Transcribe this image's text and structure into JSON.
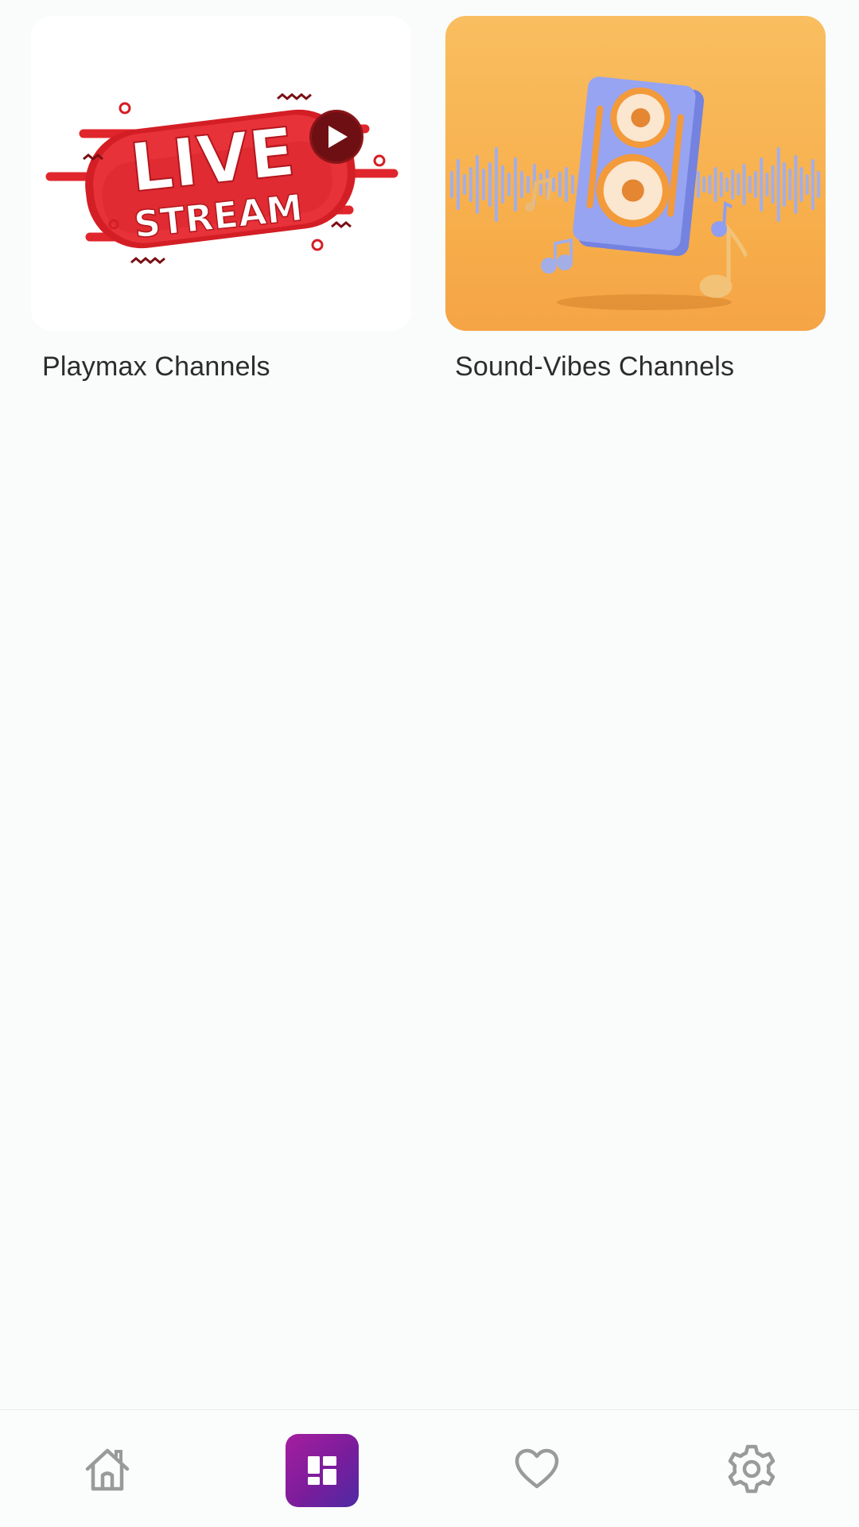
{
  "channels": [
    {
      "title": "Playmax Channels",
      "thumbnail_icon": "live-stream-banner",
      "thumbnail_text": [
        "LIVE",
        "STREAM"
      ]
    },
    {
      "title": "Sound-Vibes Channels",
      "thumbnail_icon": "speaker-with-music-notes"
    }
  ],
  "bottom_nav": {
    "items": [
      {
        "name": "home",
        "icon": "home-icon",
        "active": false
      },
      {
        "name": "dashboard",
        "icon": "dashboard-icon",
        "active": true
      },
      {
        "name": "favorites",
        "icon": "heart-icon",
        "active": false
      },
      {
        "name": "settings",
        "icon": "gear-icon",
        "active": false
      }
    ]
  },
  "colors": {
    "accent_gradient_start": "#a51e9e",
    "accent_gradient_end": "#4d2aa3",
    "live_red": "#e0262c",
    "sound_orange": "#f7ad4a",
    "speaker_blue": "#8f9ef0",
    "inactive_icon": "#9a9a9a"
  }
}
